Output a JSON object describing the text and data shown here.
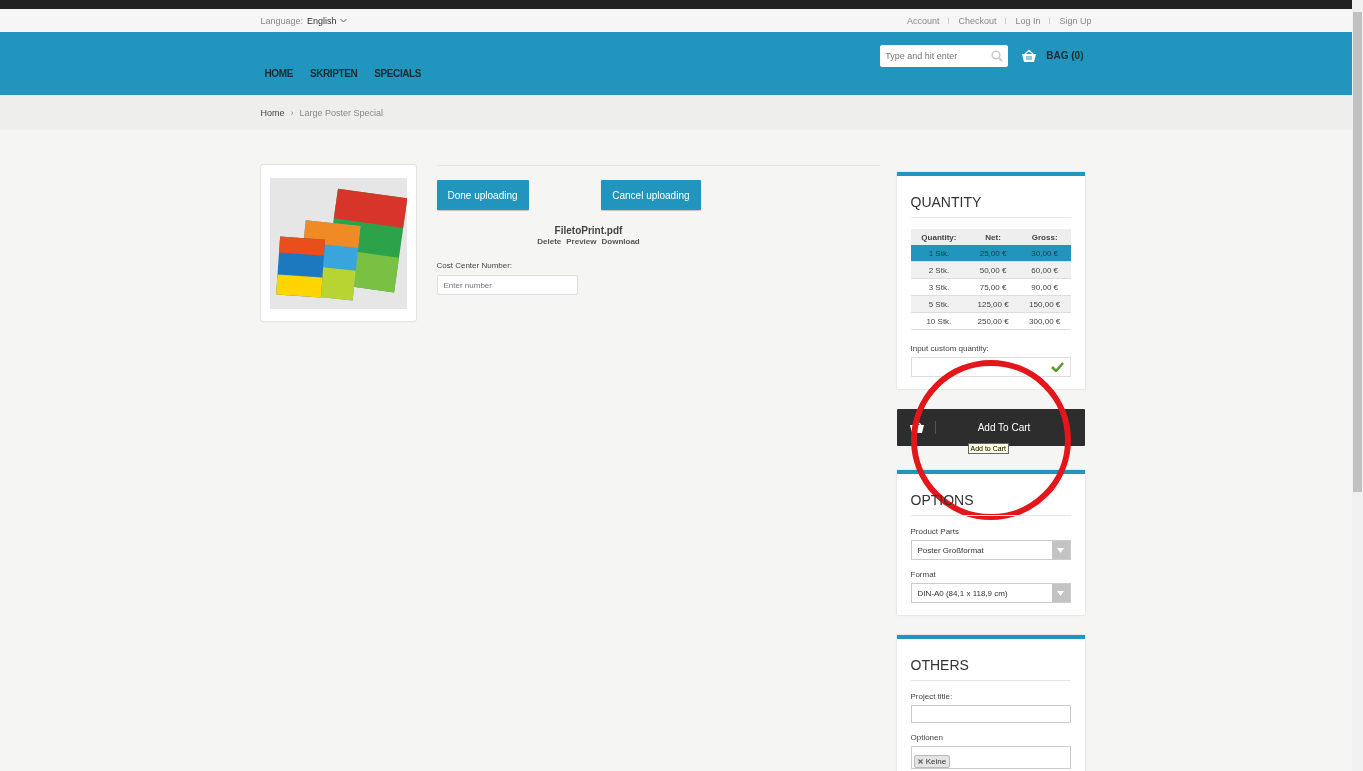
{
  "top_bar": {
    "language_label": "Language:",
    "language": "English",
    "links": [
      "Account",
      "Checkout",
      "Log In",
      "Sign Up"
    ]
  },
  "header": {
    "nav": [
      "HOME",
      "SKRIPTEN",
      "SPECIALS"
    ],
    "search": {
      "placeholder": "Type and hit enter"
    },
    "bag": "BAG (0)"
  },
  "breadcrumb": {
    "items": [
      "Home",
      "Large Poster Special"
    ],
    "separator": "›"
  },
  "upload": {
    "buttons": [
      "Done uploading",
      "Cancel uploading"
    ],
    "file_name": "FiletoPrint.pdf",
    "file_actions": [
      "Delete",
      "Preview",
      "Download"
    ],
    "cost_center": {
      "label": "Cost Center Number:",
      "placeholder": "Enter number"
    }
  },
  "quantity": {
    "title": "QUANTITY",
    "columns": [
      "Quantity:",
      "Net:",
      "Gross:"
    ],
    "rows": [
      {
        "cells": [
          "1 Stk.",
          "25,00 €",
          "30,00 €"
        ],
        "selected": true
      },
      {
        "cells": [
          "2 Stk.",
          "50,00 €",
          "60,00 €"
        ],
        "selected": false
      },
      {
        "cells": [
          "3 Stk.",
          "75,00 €",
          "90,00 €"
        ],
        "selected": false
      },
      {
        "cells": [
          "5 Stk.",
          "125,00 €",
          "150,00 €"
        ],
        "selected": false
      },
      {
        "cells": [
          "10 Stk.",
          "250,00 €",
          "300,00 €"
        ],
        "selected": false
      }
    ],
    "custom_label": "Input custom quantity:"
  },
  "add_to_cart": {
    "label": "Add To Cart",
    "tooltip": "Add to Cart"
  },
  "options": {
    "title": "OPTIONS",
    "fields": [
      {
        "label": "Product Parts",
        "value": "Poster Großformat"
      },
      {
        "label": "Format",
        "value": "DIN-A0 (84,1 x 118,9 cm)"
      }
    ]
  },
  "others": {
    "title": "OTHERS",
    "project_title_label": "Project title:",
    "optionen_label": "Optionen",
    "tags": [
      "Keine"
    ]
  }
}
